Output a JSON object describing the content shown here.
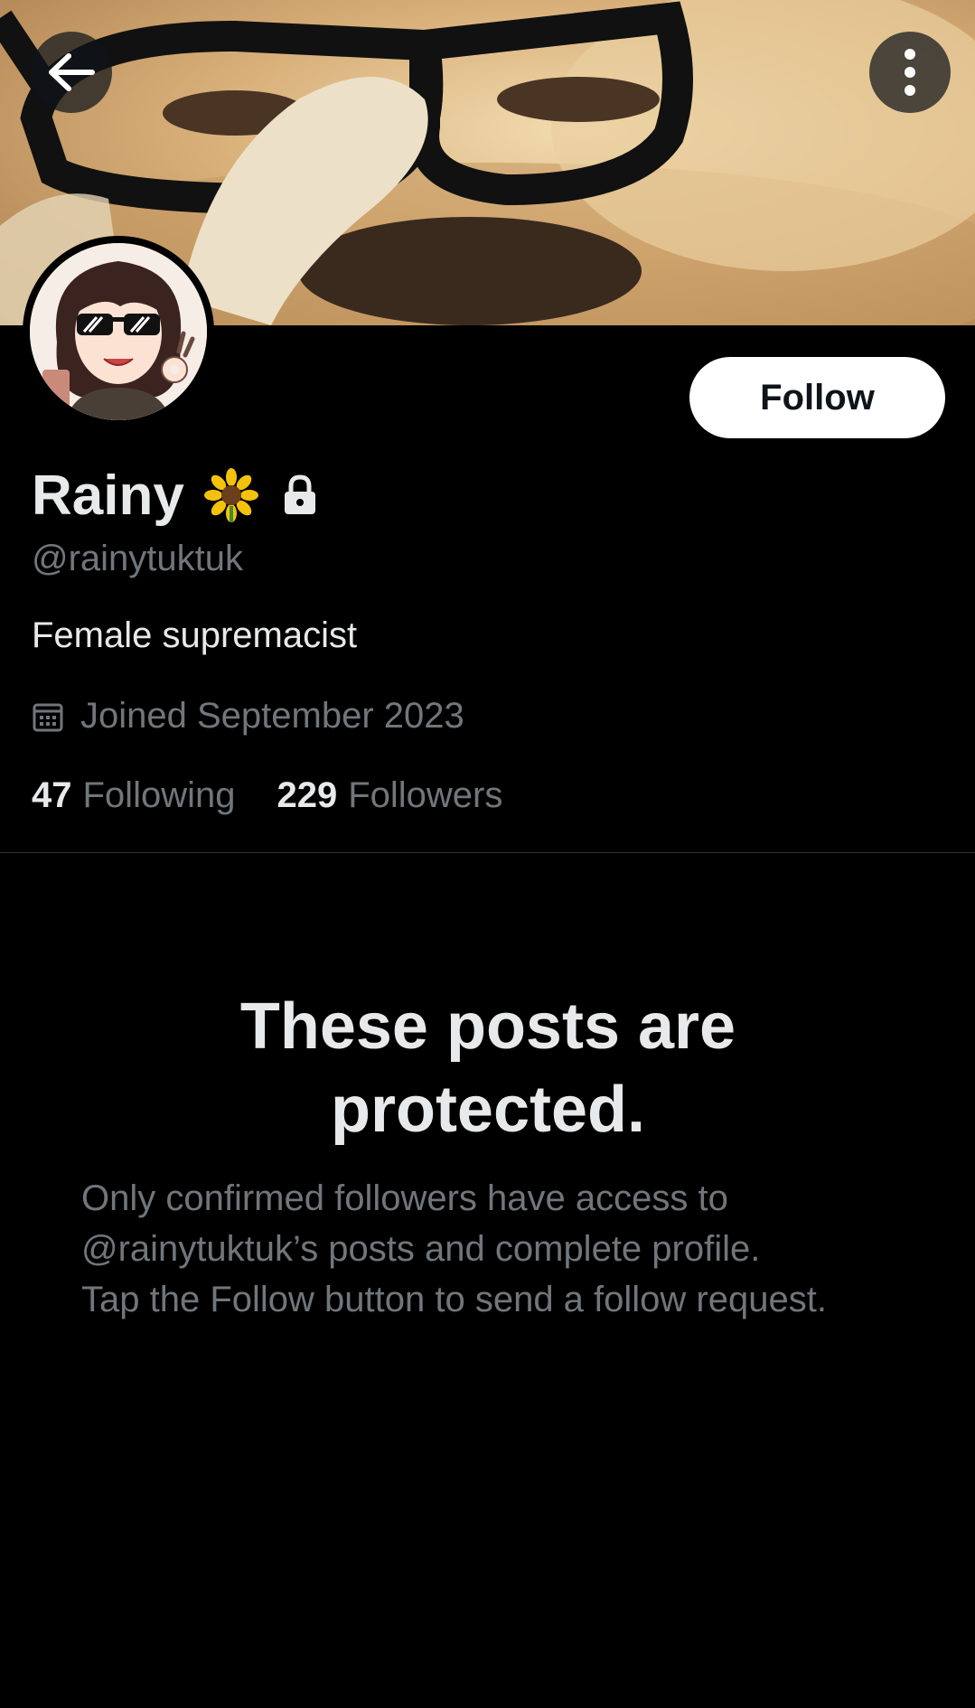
{
  "header": {
    "back_icon": "arrow-left-icon",
    "more_icon": "vertical-ellipsis-icon"
  },
  "profile": {
    "display_name": "Rainy",
    "name_emoji": "sunflower-icon",
    "protected_icon": "lock-icon",
    "handle": "@rainytuktuk",
    "bio": "Female supremacist",
    "joined": "Joined September 2023",
    "following_count": "47",
    "following_label": "Following",
    "followers_count": "229",
    "followers_label": "Followers"
  },
  "actions": {
    "follow_label": "Follow"
  },
  "protected": {
    "title": "These posts are protected.",
    "description_line1": "Only confirmed followers have access to",
    "description_line2": "@rainytuktuk’s posts and complete profile.",
    "description_line3": "Tap the Follow button to send a follow request."
  },
  "colors": {
    "background": "#000000",
    "primary_text": "#e7e9ea",
    "secondary_text": "#71767b",
    "divider": "#2f3336",
    "follow_button_bg": "#ffffff"
  }
}
